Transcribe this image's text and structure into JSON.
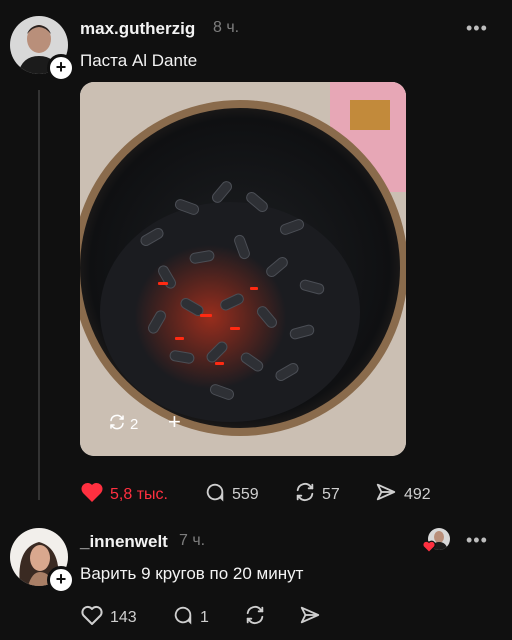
{
  "post": {
    "username": "max.gutherzig",
    "time": "8 ч.",
    "text": "Паста Al Dante",
    "media_overlay": {
      "repost_count": "2",
      "add_label": "+"
    },
    "actions": {
      "likes": "5,8 тыс.",
      "replies": "559",
      "reposts": "57",
      "shares": "492"
    },
    "more_label": "•••"
  },
  "reply": {
    "username": "_innenwelt",
    "time": "7 ч.",
    "text": "Варить 9 кругов по 20 минут",
    "actions": {
      "likes": "143",
      "replies": "1"
    },
    "more_label": "•••"
  },
  "colors": {
    "background": "#101010",
    "like_active": "#ff3040",
    "muted": "#7d7d7d"
  }
}
